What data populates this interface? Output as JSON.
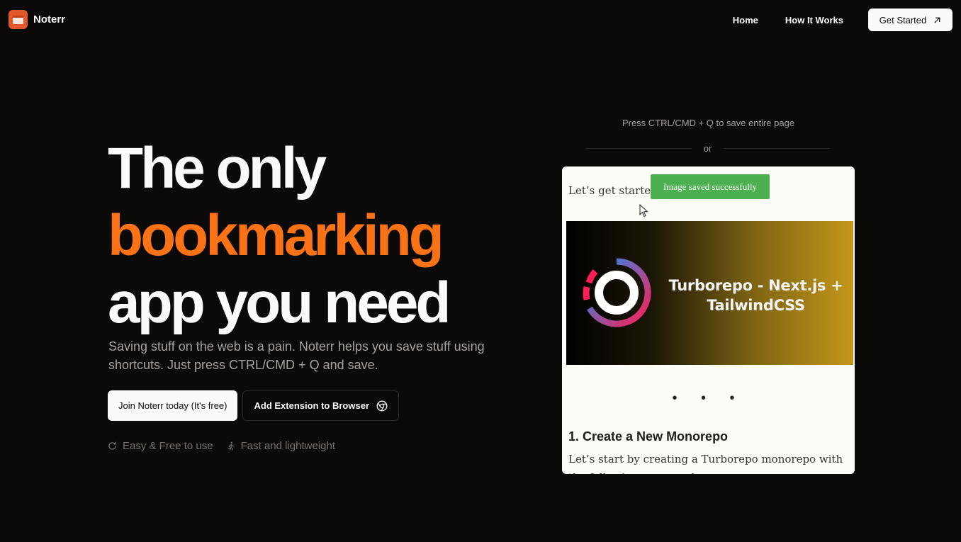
{
  "brand": {
    "name": "Noterr"
  },
  "nav": {
    "links": [
      "Home",
      "How It Works"
    ],
    "cta_label": "Get Started"
  },
  "hero": {
    "title_line1": "The only",
    "title_line2": "bookmarking",
    "title_line3": "app you need",
    "subtitle": "Saving stuff on the web is a pain. Noterr helps you save stuff using shortcuts. Just press CTRL/CMD + Q and save.",
    "primary_button": "Join Noterr today (It's free)",
    "secondary_button": "Add Extension to Browser",
    "features": [
      "Easy & Free to use",
      "Fast and lightweight"
    ]
  },
  "demo": {
    "shortcut_hint": "Press CTRL/CMD + Q to save entire page",
    "divider_text": "or",
    "intro_text": "Let’s get started!",
    "toast": "Image saved successfully",
    "banner_title": "Turborepo - Next.js + TailwindCSS",
    "dots": "• • •",
    "section_heading": "1. Create a New Monorepo",
    "section_body": "Let’s start by creating a Turborepo monorepo with the following command:"
  },
  "colors": {
    "background": "#0c0a09",
    "accent": "#f97316",
    "toast": "#4caf50"
  }
}
